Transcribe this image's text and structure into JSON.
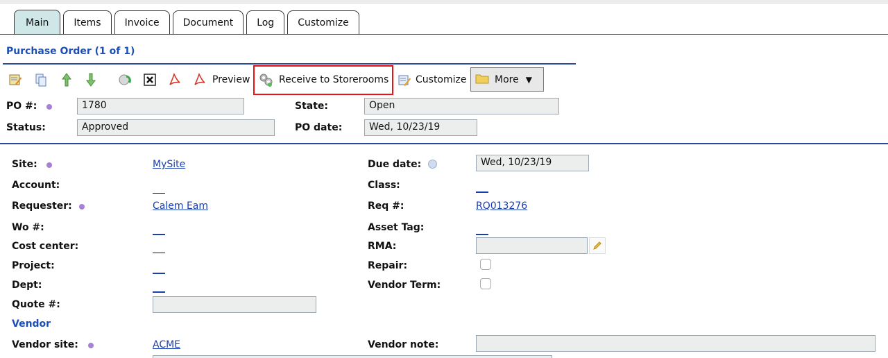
{
  "tabs": [
    "Main",
    "Items",
    "Invoice",
    "Document",
    "Log",
    "Customize"
  ],
  "section_title": "Purchase Order (1 of 1)",
  "toolbar": {
    "preview_label": "Preview",
    "receive_label": "Receive to Storerooms",
    "customize_label": "Customize",
    "more_label": "More"
  },
  "header_fields": {
    "po_label": "PO #:",
    "po_value": "1780",
    "state_label": "State:",
    "state_value": "Open",
    "status_label": "Status:",
    "status_value": "Approved",
    "po_date_label": "PO date:",
    "po_date_value": "Wed, 10/23/19"
  },
  "left_fields": {
    "site_label": "Site:",
    "site_value": "MySite",
    "account_label": "Account:",
    "requester_label": "Requester:",
    "requester_value": "Calem Eam",
    "wo_label": "Wo #:",
    "cost_center_label": "Cost center:",
    "project_label": "Project:",
    "dept_label": "Dept:",
    "quote_label": "Quote #:"
  },
  "right_fields": {
    "due_date_label": "Due date:",
    "due_date_value": "Wed, 10/23/19",
    "class_label": "Class:",
    "req_label": "Req #:",
    "req_value": "RQ013276",
    "asset_tag_label": "Asset Tag:",
    "rma_label": "RMA:",
    "repair_label": "Repair:",
    "vendor_term_label": "Vendor Term:"
  },
  "vendor": {
    "title": "Vendor",
    "vendor_site_label": "Vendor site:",
    "vendor_site_value": "ACME",
    "vendor_note_label": "Vendor note:"
  },
  "colors": {
    "accent_blue": "#1b4fb5",
    "active_tab": "#cfe7e7",
    "highlight_red": "#e11111",
    "required_dot": "#a67fd6"
  }
}
